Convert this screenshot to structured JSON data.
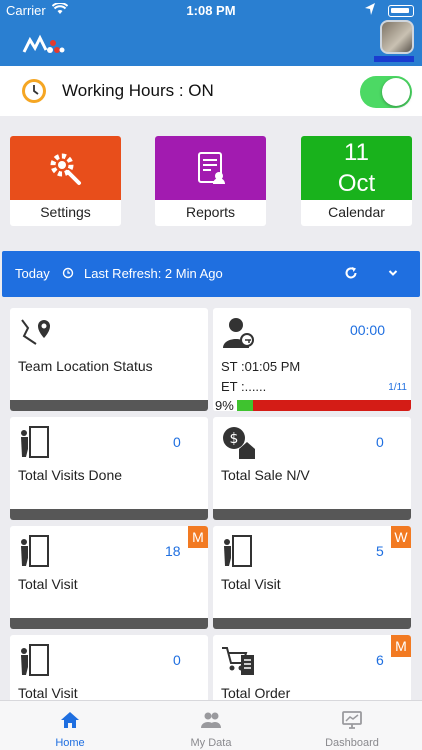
{
  "status_bar": {
    "carrier": "Carrier",
    "time": "1:08 PM"
  },
  "working_hours": {
    "label": "Working Hours : ON",
    "toggle_on": true
  },
  "quick_tiles": [
    {
      "label": "Settings",
      "color": "#e84e1b",
      "icon": "gear-wrench-icon"
    },
    {
      "label": "Reports",
      "color": "#a21bb0",
      "icon": "report-document-icon"
    },
    {
      "label": "Calendar",
      "color": "#19b21c",
      "day": "11",
      "month": "Oct"
    }
  ],
  "refresh_bar": {
    "period": "Today",
    "last_refresh": "Last Refresh: 2 Min Ago",
    "color": "#1f6fe0"
  },
  "cards": {
    "team_location": {
      "title": "Team Location Status"
    },
    "hours": {
      "timer": "00:00",
      "start": "ST :01:05 PM",
      "end": "ET :......",
      "page": "1/11",
      "percent_label": "9%",
      "percent": 0.09
    },
    "visits_done": {
      "title": "Total Visits Done",
      "count": "0"
    },
    "total_sale": {
      "title": "Total Sale  N/V",
      "count": "0"
    },
    "visit_m": {
      "title": "Total Visit",
      "count": "18",
      "badge": "M"
    },
    "visit_w": {
      "title": "Total Visit",
      "count": "5",
      "badge": "W"
    },
    "visit_3": {
      "title": "Total Visit",
      "count": "0"
    },
    "order_m": {
      "title": "Total Order",
      "count": "6",
      "badge": "M"
    }
  },
  "tabs": [
    {
      "label": "Home",
      "active": true,
      "icon": "home-icon"
    },
    {
      "label": "My Data",
      "active": false,
      "icon": "users-icon"
    },
    {
      "label": "Dashboard",
      "active": false,
      "icon": "dashboard-icon"
    }
  ]
}
